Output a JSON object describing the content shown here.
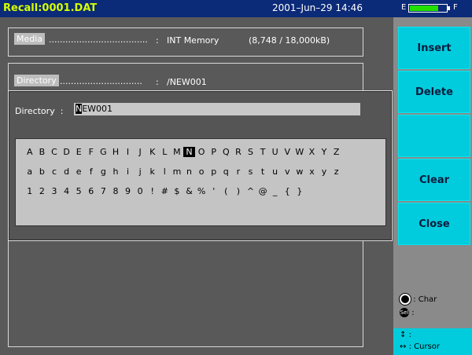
{
  "title": "Recall:0001.DAT",
  "datetime": "2001–Jun–29 14:46",
  "battery": {
    "empty_label": "E",
    "full_label": "F",
    "level": 0.78,
    "color": "#22e000"
  },
  "media": {
    "label": "Media",
    "dots": "....................................",
    "sep": ":",
    "value": "INT Memory",
    "usage": "(8,748 / 18,000kB)"
  },
  "directory": {
    "label": "Directory",
    "dots": "..............................",
    "sep": ":",
    "value": "/NEW001"
  },
  "dialog": {
    "label": "Directory",
    "sep": ":",
    "input_first": "N",
    "input_rest": "EW001"
  },
  "keyboard": {
    "row1": [
      "A",
      "B",
      "C",
      "D",
      "E",
      "F",
      "G",
      "H",
      "I",
      "J",
      "K",
      "L",
      "M",
      "N",
      "O",
      "P",
      "Q",
      "R",
      "S",
      "T",
      "U",
      "V",
      "W",
      "X",
      "Y",
      "Z"
    ],
    "row2": [
      "a",
      "b",
      "c",
      "d",
      "e",
      "f",
      "g",
      "h",
      "i",
      "j",
      "k",
      "l",
      "m",
      "n",
      "o",
      "p",
      "q",
      "r",
      "s",
      "t",
      "u",
      "v",
      "w",
      "x",
      "y",
      "z"
    ],
    "row3": [
      "1",
      "2",
      "3",
      "4",
      "5",
      "6",
      "7",
      "8",
      "9",
      "0",
      "!",
      "#",
      "$",
      "&",
      "%",
      "'",
      "(",
      ")",
      "^",
      "@",
      "_",
      "{",
      "}"
    ],
    "selected": "N"
  },
  "softkeys": {
    "insert": "Insert",
    "delete": "Delete",
    "empty": "",
    "clear": "Clear",
    "close": "Close"
  },
  "legend": {
    "knob_text": ": Char",
    "sel_icon_text": "Sel",
    "sel_text": ":",
    "updown_text": ":",
    "leftright_text": ": Cursor"
  },
  "colors": {
    "titlebar": "#0b2a78",
    "title_text": "#d6ff00",
    "softkey": "#00ccdd",
    "panel": "#595959"
  }
}
